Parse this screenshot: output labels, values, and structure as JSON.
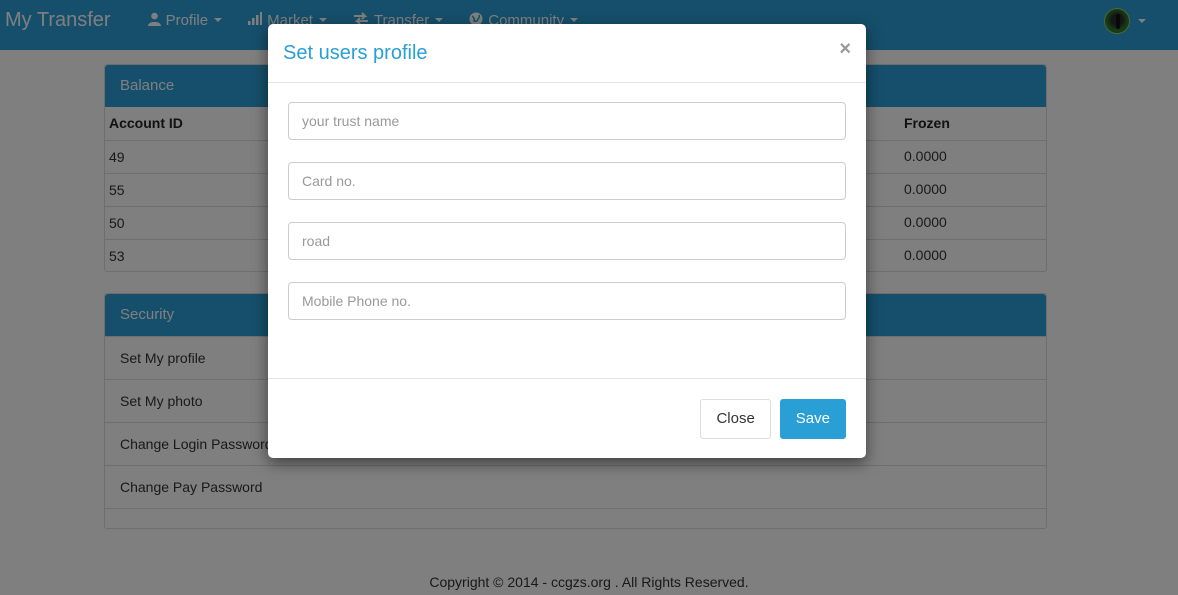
{
  "navbar": {
    "brand": "My Transfer",
    "items": [
      {
        "label": "Profile",
        "icon": "user-icon"
      },
      {
        "label": "Market",
        "icon": "signal-bars-icon"
      },
      {
        "label": "Transfer",
        "icon": "transfer-arrows-icon"
      },
      {
        "label": "Community",
        "icon": "globe-icon"
      }
    ],
    "accent_color": "#2a9fd6"
  },
  "balance": {
    "heading": "Balance",
    "columns": {
      "account_id": "Account ID",
      "frozen": "Frozen"
    },
    "rows": [
      {
        "account_id": "49",
        "frozen": "0.0000"
      },
      {
        "account_id": "55",
        "frozen": "0.0000"
      },
      {
        "account_id": "50",
        "frozen": "0.0000"
      },
      {
        "account_id": "53",
        "frozen": "0.0000"
      }
    ]
  },
  "security": {
    "heading": "Security",
    "items": [
      {
        "label": "Set My profile"
      },
      {
        "label": "Set My photo"
      },
      {
        "label": "Change Login Password"
      },
      {
        "label": "Change Pay Password"
      }
    ]
  },
  "footer": {
    "text": "Copyright © 2014 - ccgzs.org . All Rights Reserved."
  },
  "modal": {
    "title": "Set users profile",
    "close_glyph": "×",
    "fields": {
      "trust_name": {
        "placeholder": "your trust name",
        "value": ""
      },
      "card_no": {
        "placeholder": "Card no.",
        "value": ""
      },
      "road": {
        "placeholder": "road",
        "value": ""
      },
      "mobile": {
        "placeholder": "Mobile Phone no.",
        "value": ""
      }
    },
    "close_label": "Close",
    "save_label": "Save"
  }
}
